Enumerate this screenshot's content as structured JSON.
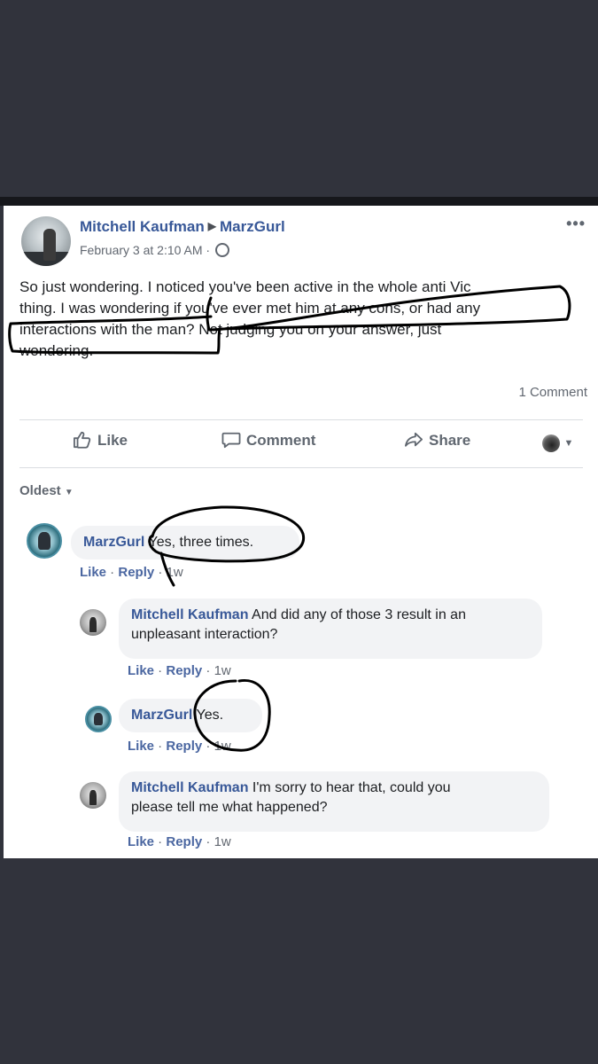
{
  "post": {
    "author": "Mitchell Kaufman",
    "target": "MarzGurl",
    "timestamp": "February 3 at 2:10 AM",
    "privacy_icon": "globe-icon",
    "text_lines": [
      "So just wondering. I noticed you've been active in the whole anti Vic",
      "thing. I was wondering if you've ever met him at any cons, or had any",
      "interactions with the man? Not judging you on your answer, just",
      "wondering."
    ],
    "comment_count": "1 Comment"
  },
  "actions": {
    "like": "Like",
    "comment": "Comment",
    "share": "Share"
  },
  "sort_label": "Oldest",
  "comments": [
    {
      "author": "MarzGurl",
      "text": "Yes, three times.",
      "like": "Like",
      "reply": "Reply",
      "time": "1w"
    },
    {
      "author": "Mitchell Kaufman",
      "text_lines": [
        "And did any of those 3 result in an",
        "unpleasant interaction?"
      ],
      "like": "Like",
      "reply": "Reply",
      "time": "1w"
    },
    {
      "author": "MarzGurl",
      "text": "Yes.",
      "like": "Like",
      "reply": "Reply",
      "time": "1w"
    },
    {
      "author": "Mitchell Kaufman",
      "text_lines": [
        "I'm sorry to hear that, could you",
        "please tell me what happened?"
      ],
      "like": "Like",
      "reply": "Reply",
      "time": "1w"
    }
  ],
  "colors": {
    "background": "#31333c",
    "card": "#ffffff",
    "name_link": "#385898",
    "bubble": "#f2f3f5",
    "annotation_ink": "#000000"
  }
}
